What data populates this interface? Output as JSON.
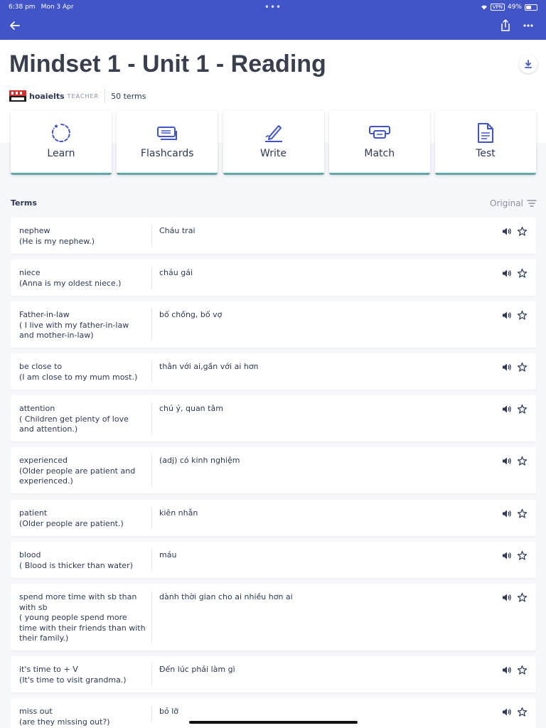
{
  "status": {
    "time": "6:38 pm",
    "date": "Mon 3 Apr",
    "vpn": "VPN",
    "battery": "49%",
    "battery_level": 0.49
  },
  "header": {
    "title": "Mindset 1 - Unit 1 - Reading",
    "author": "hoaielts",
    "role": "TEACHER",
    "terms_count": "50 terms"
  },
  "modes": [
    {
      "label": "Learn",
      "icon": "learn-icon"
    },
    {
      "label": "Flashcards",
      "icon": "flashcards-icon"
    },
    {
      "label": "Write",
      "icon": "write-icon"
    },
    {
      "label": "Match",
      "icon": "match-icon"
    },
    {
      "label": "Test",
      "icon": "test-icon"
    }
  ],
  "terms_section": {
    "title": "Terms",
    "sort_label": "Original"
  },
  "terms": [
    {
      "word": "nephew\n(He is my nephew.)",
      "definition": "Cháu trai"
    },
    {
      "word": "niece\n(Anna is my oldest niece.)",
      "definition": "cháu gái"
    },
    {
      "word": "Father-in-law\n ( I live with my father-in-law\nand mother-in-law)",
      "definition": "bố chồng, bố vợ"
    },
    {
      "word": "be close to\n(I am close to my mum most.)",
      "definition": "thân với ai,gần với ai hơn"
    },
    {
      "word": "attention\n( Children get plenty of love\nand attention.)",
      "definition": "chú ý, quan tâm"
    },
    {
      "word": "experienced\n (Older people are patient and\nexperienced.)",
      "definition": "(adj) có kinh nghiệm"
    },
    {
      "word": "patient\n(Older people are patient.)",
      "definition": "kiên nhẫn"
    },
    {
      "word": "blood\n( Blood is thicker than water)",
      "definition": "máu"
    },
    {
      "word": "spend more time with sb than\nwith sb\n( young people spend more\ntime with their friends than with\ntheir family.)",
      "definition": "dành thời gian cho ai nhiều hơn ai"
    },
    {
      "word": "it's time to + V\n(It's time to visit grandma.)",
      "definition": "Đến lúc phải làm gì"
    },
    {
      "word": "miss out\n(are they missing out?)",
      "definition": "bỏ lỡ"
    }
  ]
}
